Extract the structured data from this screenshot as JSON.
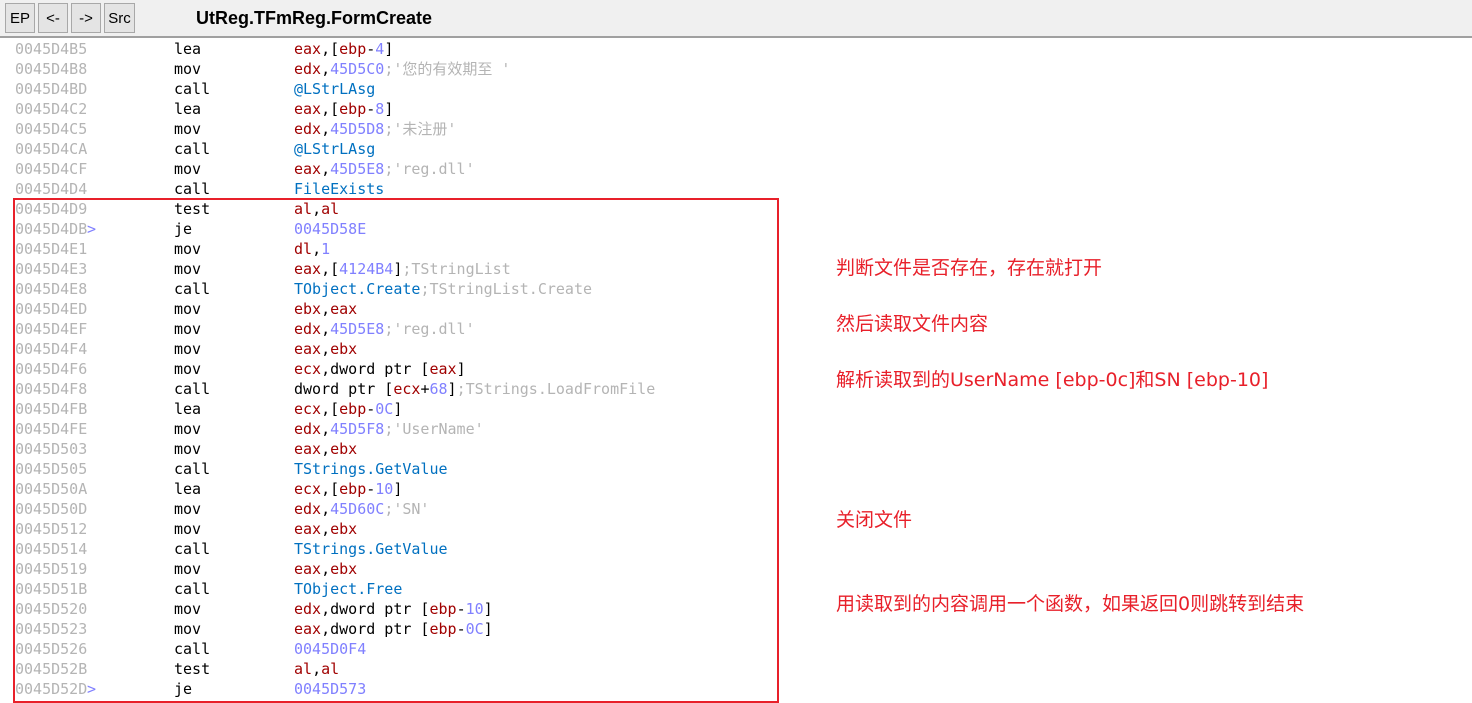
{
  "toolbar": {
    "ep": "EP",
    "back": "<-",
    "forward": "->",
    "src": "Src",
    "title": "UtReg.TFmReg.FormCreate"
  },
  "rows": [
    {
      "addr": "0045D4B5",
      "mn": "lea",
      "ops": [
        [
          "reg",
          "eax"
        ],
        [
          "pl",
          ",["
        ],
        [
          "reg",
          "ebp"
        ],
        [
          "pl",
          "-"
        ],
        [
          "num",
          "4"
        ],
        [
          "pl",
          "]"
        ]
      ]
    },
    {
      "addr": "0045D4B8",
      "mn": "mov",
      "ops": [
        [
          "reg",
          "edx"
        ],
        [
          "pl",
          ","
        ],
        [
          "num",
          "45D5C0"
        ],
        [
          "cmt",
          ";'您的有效期至 '"
        ]
      ]
    },
    {
      "addr": "0045D4BD",
      "mn": "call",
      "ops": [
        [
          "sym",
          "@LStrLAsg"
        ]
      ]
    },
    {
      "addr": "0045D4C2",
      "mn": "lea",
      "ops": [
        [
          "reg",
          "eax"
        ],
        [
          "pl",
          ",["
        ],
        [
          "reg",
          "ebp"
        ],
        [
          "pl",
          "-"
        ],
        [
          "num",
          "8"
        ],
        [
          "pl",
          "]"
        ]
      ]
    },
    {
      "addr": "0045D4C5",
      "mn": "mov",
      "ops": [
        [
          "reg",
          "edx"
        ],
        [
          "pl",
          ","
        ],
        [
          "num",
          "45D5D8"
        ],
        [
          "cmt",
          ";'未注册'"
        ]
      ]
    },
    {
      "addr": "0045D4CA",
      "mn": "call",
      "ops": [
        [
          "sym",
          "@LStrLAsg"
        ]
      ]
    },
    {
      "addr": "0045D4CF",
      "mn": "mov",
      "ops": [
        [
          "reg",
          "eax"
        ],
        [
          "pl",
          ","
        ],
        [
          "num",
          "45D5E8"
        ],
        [
          "cmt",
          ";'reg.dll'"
        ]
      ]
    },
    {
      "addr": "0045D4D4",
      "mn": "call",
      "ops": [
        [
          "sym",
          "FileExists"
        ]
      ]
    },
    {
      "addr": "0045D4D9",
      "mn": "test",
      "ops": [
        [
          "reg",
          "al"
        ],
        [
          "pl",
          ","
        ],
        [
          "reg",
          "al"
        ]
      ]
    },
    {
      "addr": "0045D4DB",
      "jump": ">",
      "mn": "je",
      "ops": [
        [
          "num",
          "0045D58E"
        ]
      ]
    },
    {
      "addr": "0045D4E1",
      "mn": "mov",
      "ops": [
        [
          "reg",
          "dl"
        ],
        [
          "pl",
          ","
        ],
        [
          "num",
          "1"
        ]
      ]
    },
    {
      "addr": "0045D4E3",
      "mn": "mov",
      "ops": [
        [
          "reg",
          "eax"
        ],
        [
          "pl",
          ",["
        ],
        [
          "num",
          "4124B4"
        ],
        [
          "pl",
          "]"
        ],
        [
          "cmt",
          ";TStringList"
        ]
      ]
    },
    {
      "addr": "0045D4E8",
      "mn": "call",
      "ops": [
        [
          "sym",
          "TObject.Create"
        ],
        [
          "cmt",
          ";TStringList.Create"
        ]
      ]
    },
    {
      "addr": "0045D4ED",
      "mn": "mov",
      "ops": [
        [
          "reg",
          "ebx"
        ],
        [
          "pl",
          ","
        ],
        [
          "reg",
          "eax"
        ]
      ]
    },
    {
      "addr": "0045D4EF",
      "mn": "mov",
      "ops": [
        [
          "reg",
          "edx"
        ],
        [
          "pl",
          ","
        ],
        [
          "num",
          "45D5E8"
        ],
        [
          "cmt",
          ";'reg.dll'"
        ]
      ]
    },
    {
      "addr": "0045D4F4",
      "mn": "mov",
      "ops": [
        [
          "reg",
          "eax"
        ],
        [
          "pl",
          ","
        ],
        [
          "reg",
          "ebx"
        ]
      ]
    },
    {
      "addr": "0045D4F6",
      "mn": "mov",
      "ops": [
        [
          "reg",
          "ecx"
        ],
        [
          "pl",
          ",dword ptr ["
        ],
        [
          "reg",
          "eax"
        ],
        [
          "pl",
          "]"
        ]
      ]
    },
    {
      "addr": "0045D4F8",
      "mn": "call",
      "ops": [
        [
          "pl",
          "dword ptr ["
        ],
        [
          "reg",
          "ecx"
        ],
        [
          "pl",
          "+"
        ],
        [
          "num",
          "68"
        ],
        [
          "pl",
          "]"
        ],
        [
          "cmt",
          ";TStrings.LoadFromFile"
        ]
      ]
    },
    {
      "addr": "0045D4FB",
      "mn": "lea",
      "ops": [
        [
          "reg",
          "ecx"
        ],
        [
          "pl",
          ",["
        ],
        [
          "reg",
          "ebp"
        ],
        [
          "pl",
          "-"
        ],
        [
          "num",
          "0C"
        ],
        [
          "pl",
          "]"
        ]
      ]
    },
    {
      "addr": "0045D4FE",
      "mn": "mov",
      "ops": [
        [
          "reg",
          "edx"
        ],
        [
          "pl",
          ","
        ],
        [
          "num",
          "45D5F8"
        ],
        [
          "cmt",
          ";'UserName'"
        ]
      ]
    },
    {
      "addr": "0045D503",
      "mn": "mov",
      "ops": [
        [
          "reg",
          "eax"
        ],
        [
          "pl",
          ","
        ],
        [
          "reg",
          "ebx"
        ]
      ]
    },
    {
      "addr": "0045D505",
      "mn": "call",
      "ops": [
        [
          "sym",
          "TStrings.GetValue"
        ]
      ]
    },
    {
      "addr": "0045D50A",
      "mn": "lea",
      "ops": [
        [
          "reg",
          "ecx"
        ],
        [
          "pl",
          ",["
        ],
        [
          "reg",
          "ebp"
        ],
        [
          "pl",
          "-"
        ],
        [
          "num",
          "10"
        ],
        [
          "pl",
          "]"
        ]
      ]
    },
    {
      "addr": "0045D50D",
      "mn": "mov",
      "ops": [
        [
          "reg",
          "edx"
        ],
        [
          "pl",
          ","
        ],
        [
          "num",
          "45D60C"
        ],
        [
          "cmt",
          ";'SN'"
        ]
      ]
    },
    {
      "addr": "0045D512",
      "mn": "mov",
      "ops": [
        [
          "reg",
          "eax"
        ],
        [
          "pl",
          ","
        ],
        [
          "reg",
          "ebx"
        ]
      ]
    },
    {
      "addr": "0045D514",
      "mn": "call",
      "ops": [
        [
          "sym",
          "TStrings.GetValue"
        ]
      ]
    },
    {
      "addr": "0045D519",
      "mn": "mov",
      "ops": [
        [
          "reg",
          "eax"
        ],
        [
          "pl",
          ","
        ],
        [
          "reg",
          "ebx"
        ]
      ]
    },
    {
      "addr": "0045D51B",
      "mn": "call",
      "ops": [
        [
          "sym",
          "TObject.Free"
        ]
      ]
    },
    {
      "addr": "0045D520",
      "mn": "mov",
      "ops": [
        [
          "reg",
          "edx"
        ],
        [
          "pl",
          ",dword ptr ["
        ],
        [
          "reg",
          "ebp"
        ],
        [
          "pl",
          "-"
        ],
        [
          "num",
          "10"
        ],
        [
          "pl",
          "]"
        ]
      ]
    },
    {
      "addr": "0045D523",
      "mn": "mov",
      "ops": [
        [
          "reg",
          "eax"
        ],
        [
          "pl",
          ",dword ptr ["
        ],
        [
          "reg",
          "ebp"
        ],
        [
          "pl",
          "-"
        ],
        [
          "num",
          "0C"
        ],
        [
          "pl",
          "]"
        ]
      ]
    },
    {
      "addr": "0045D526",
      "mn": "call",
      "ops": [
        [
          "num",
          "0045D0F4"
        ]
      ]
    },
    {
      "addr": "0045D52B",
      "mn": "test",
      "ops": [
        [
          "reg",
          "al"
        ],
        [
          "pl",
          ","
        ],
        [
          "reg",
          "al"
        ]
      ]
    },
    {
      "addr": "0045D52D",
      "jump": ">",
      "mn": "je",
      "ops": [
        [
          "num",
          "0045D573"
        ]
      ]
    }
  ],
  "annotations": [
    "判断文件是否存在，存在就打开",
    "然后读取文件内容",
    "解析读取到的UserName [ebp-0c]和SN [ebp-10]",
    "关闭文件",
    "用读取到的内容调用一个函数，如果返回0则跳转到结束"
  ],
  "colors": {
    "highlight": "#e8202a"
  }
}
